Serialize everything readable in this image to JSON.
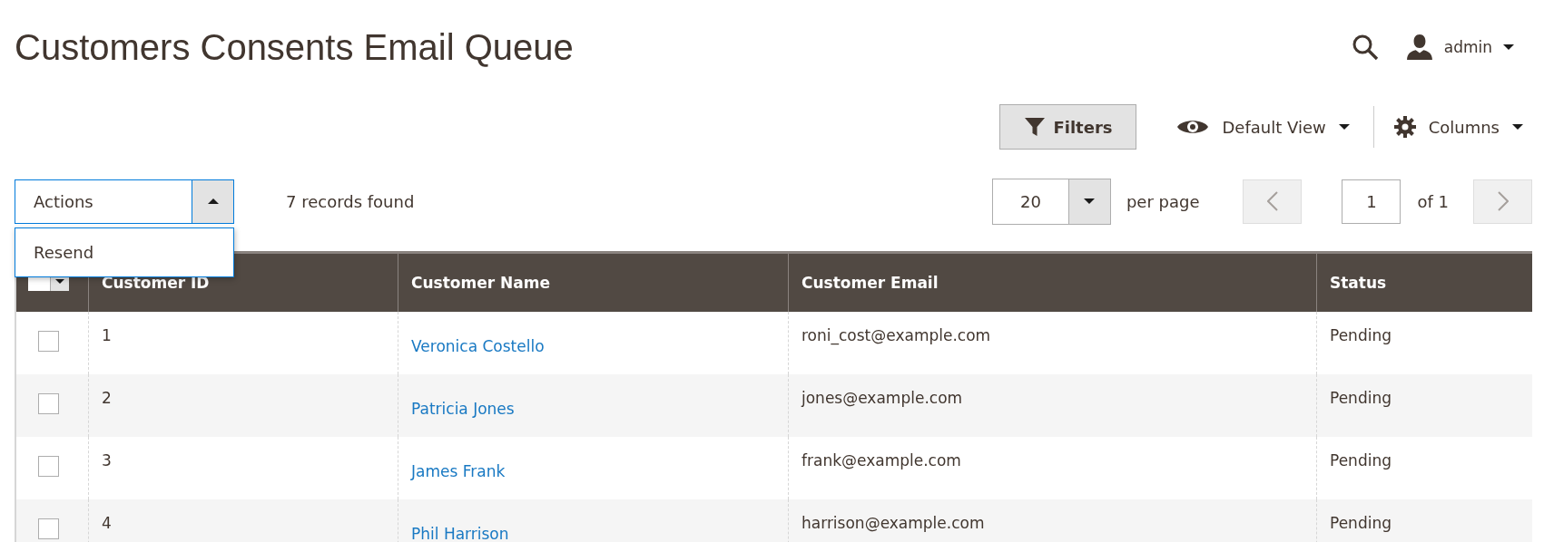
{
  "page": {
    "title": "Customers Consents Email Queue"
  },
  "header": {
    "user": "admin"
  },
  "toolbar": {
    "filters": "Filters",
    "view": "Default View",
    "columns": "Columns"
  },
  "actions": {
    "label": "Actions",
    "expanded": true,
    "options": [
      "Resend"
    ]
  },
  "records": "7 records found",
  "pagination": {
    "per_page": "20",
    "per_page_label": "per page",
    "page": "1",
    "of": "of 1",
    "prev_disabled": true,
    "next_disabled": true
  },
  "table": {
    "select_all_checked": false,
    "columns": [
      {
        "label": "Customer ID",
        "kind": "text"
      },
      {
        "label": "Customer Name",
        "kind": "link"
      },
      {
        "label": "Customer Email",
        "kind": "text"
      },
      {
        "label": "Status",
        "kind": "text"
      }
    ],
    "rows": [
      {
        "checked": false,
        "cells": [
          "1",
          "Veronica Costello",
          "roni_cost@example.com",
          "Pending"
        ]
      },
      {
        "checked": false,
        "cells": [
          "2",
          "Patricia Jones",
          "jones@example.com",
          "Pending"
        ]
      },
      {
        "checked": false,
        "cells": [
          "3",
          "James Frank",
          "frank@example.com",
          "Pending"
        ]
      },
      {
        "checked": false,
        "cells": [
          "4",
          "Phil Harrison",
          "harrison@example.com",
          "Pending"
        ]
      }
    ]
  }
}
